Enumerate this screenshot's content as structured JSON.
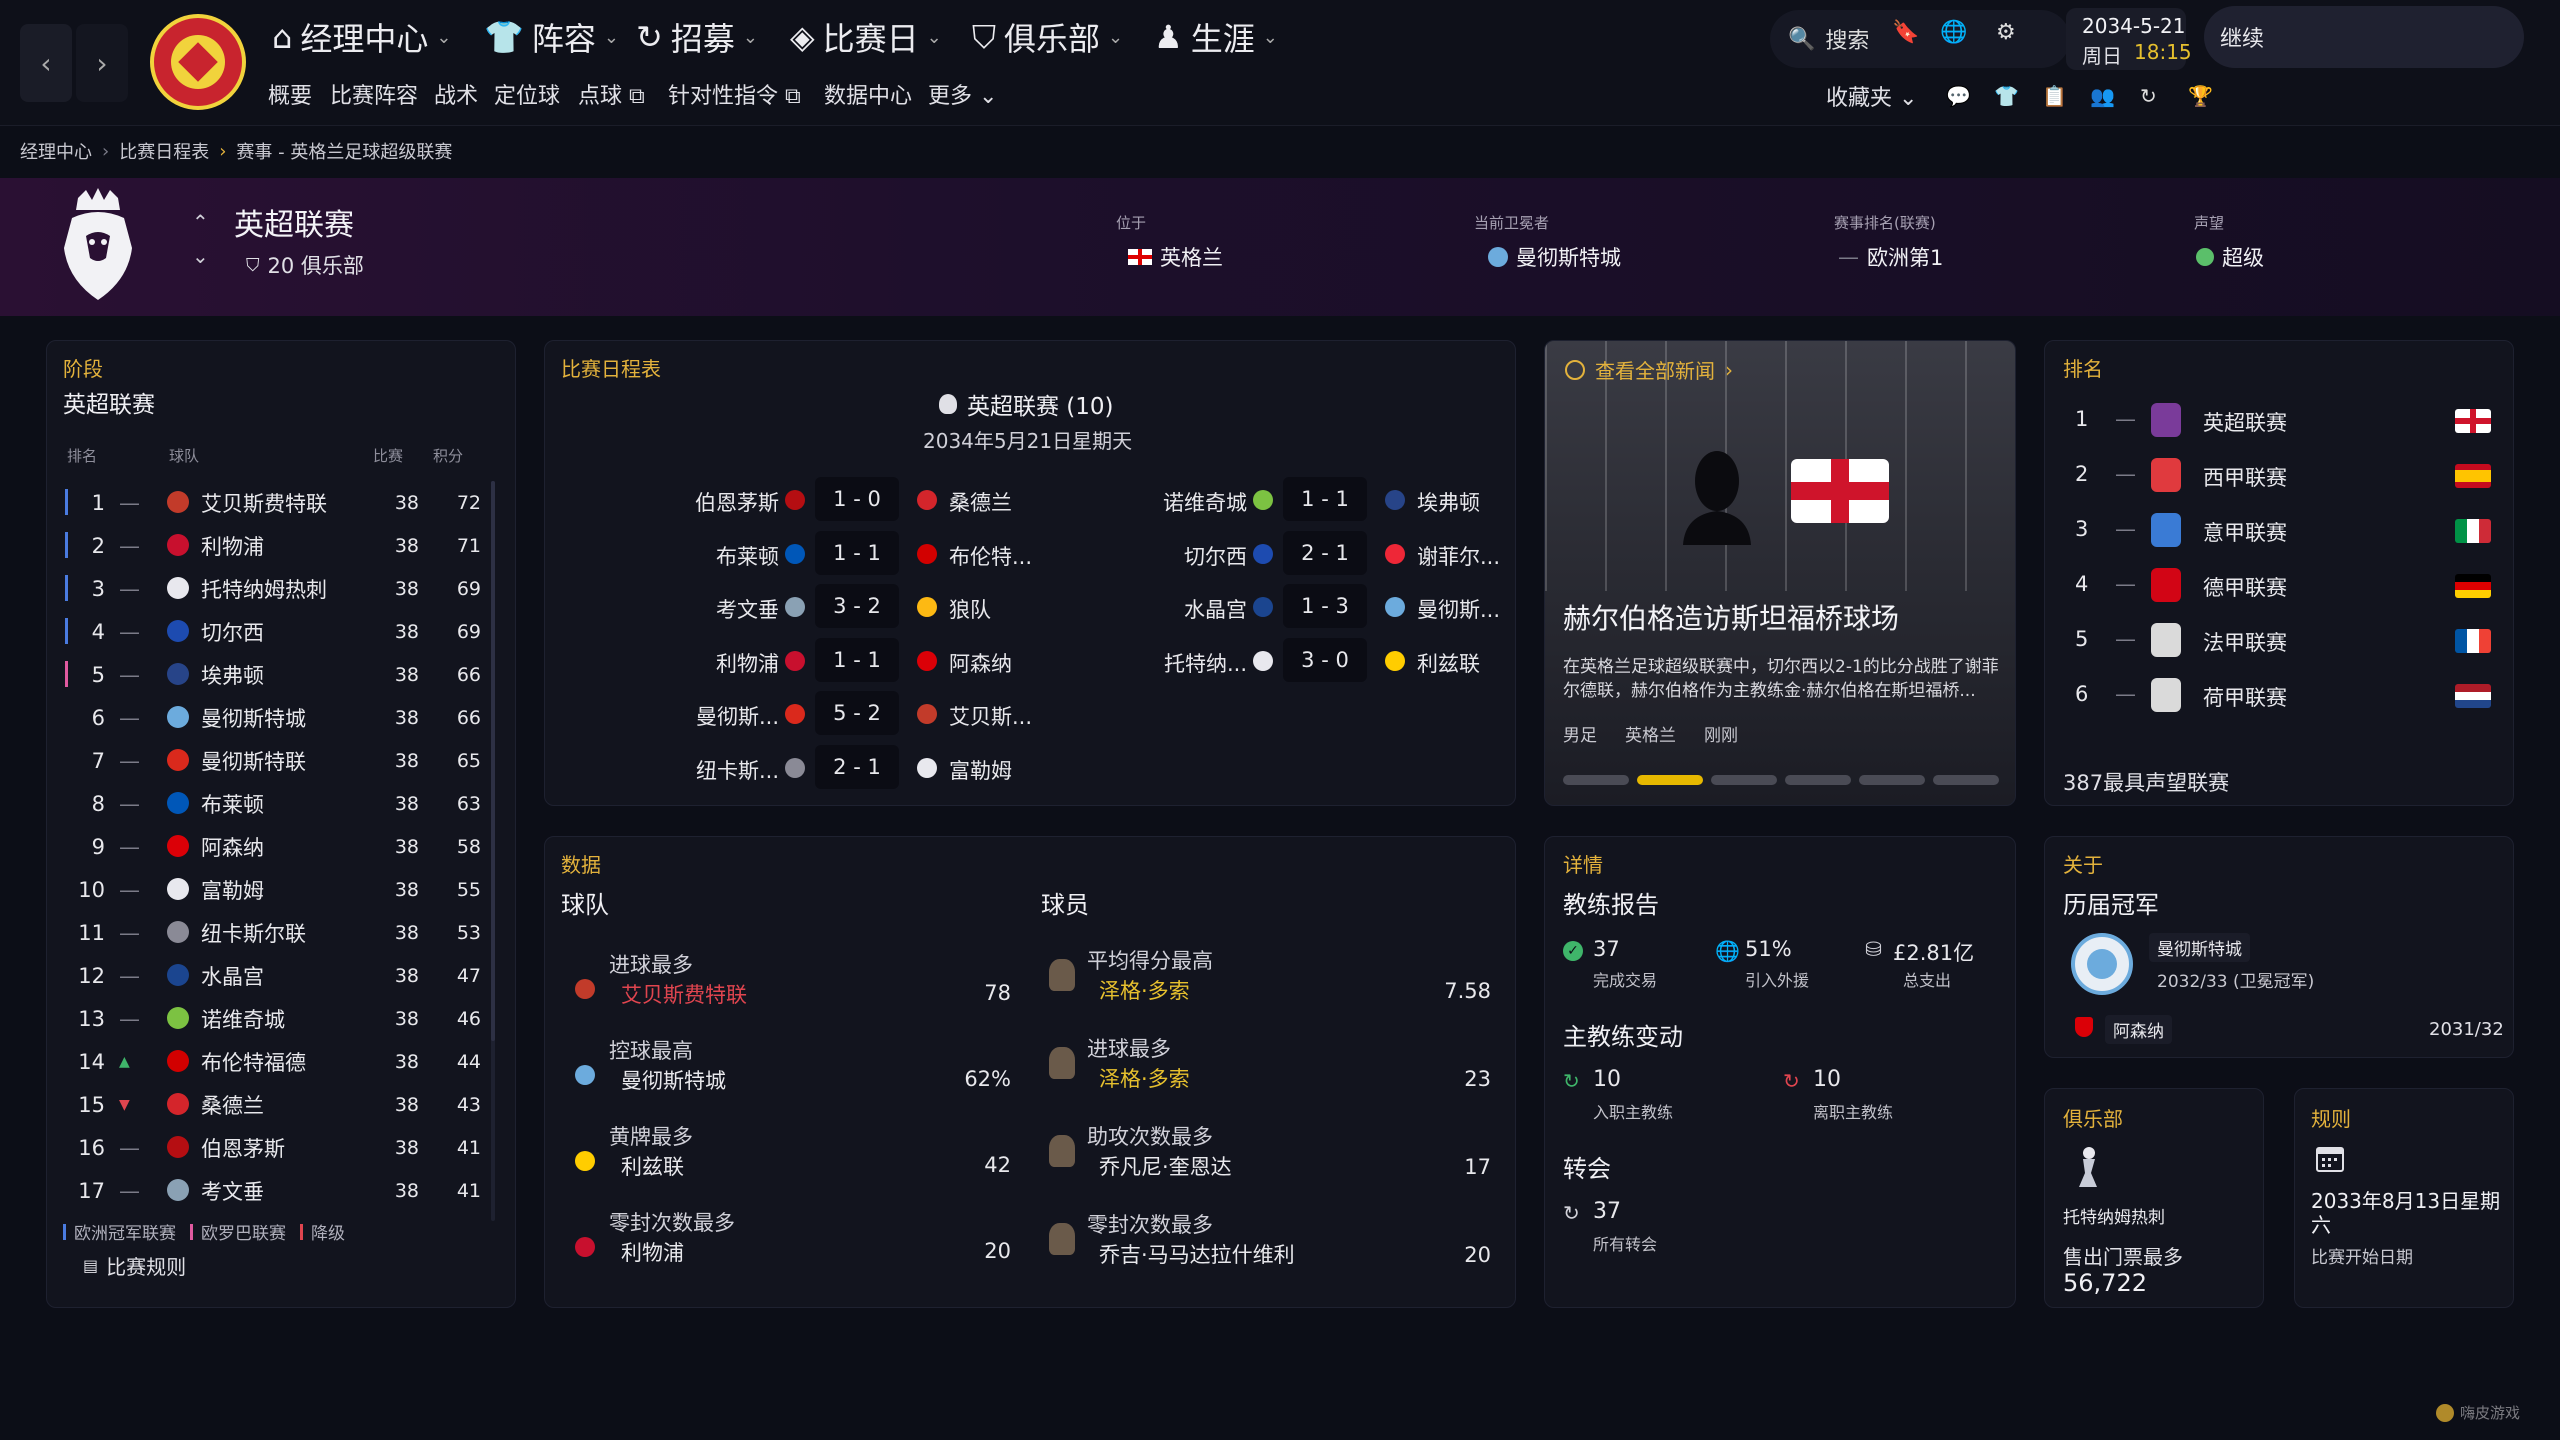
{
  "top_nav": {
    "menus": [
      "经理中心",
      "阵容",
      "招募",
      "比赛日",
      "俱乐部",
      "生涯"
    ],
    "submenu": [
      "概要",
      "比赛阵容",
      "战术",
      "定位球",
      "点球",
      "针对性指令",
      "数据中心",
      "更多"
    ],
    "search_label": "搜索",
    "favorites_label": "收藏夹",
    "date": "2034-5-21",
    "weekday": "周日",
    "time": "18:15",
    "continue_label": "继续"
  },
  "breadcrumb": [
    "经理中心",
    "比赛日程表",
    "赛事 - 英格兰足球超级联赛"
  ],
  "competition": {
    "name": "英超联赛",
    "clubs": "20 俱乐部",
    "location_label": "位于",
    "location": "英格兰",
    "holder_label": "当前卫冕者",
    "holder": "曼彻斯特城",
    "ranking_label": "赛事排名(联赛)",
    "ranking": "欧洲第1",
    "reputation_label": "声望",
    "reputation": "超级"
  },
  "stage": {
    "title": "阶段",
    "name": "英超联赛",
    "headers": [
      "排名",
      "球队",
      "比赛",
      "积分"
    ],
    "rows": [
      {
        "rank": "1",
        "trend": "—",
        "team": "艾贝斯费特联",
        "played": "38",
        "pts": "72",
        "zone": "#4a7be0",
        "crest": "#c23b2a"
      },
      {
        "rank": "2",
        "trend": "—",
        "team": "利物浦",
        "played": "38",
        "pts": "71",
        "zone": "#4a7be0",
        "crest": "#c8102e"
      },
      {
        "rank": "3",
        "trend": "—",
        "team": "托特纳姆热刺",
        "played": "38",
        "pts": "69",
        "zone": "#4a7be0",
        "crest": "#e8e8ee"
      },
      {
        "rank": "4",
        "trend": "—",
        "team": "切尔西",
        "played": "38",
        "pts": "69",
        "zone": "#4a7be0",
        "crest": "#1d4bb0"
      },
      {
        "rank": "5",
        "trend": "—",
        "team": "埃弗顿",
        "played": "38",
        "pts": "66",
        "zone": "#e05aa0",
        "crest": "#274488"
      },
      {
        "rank": "6",
        "trend": "—",
        "team": "曼彻斯特城",
        "played": "38",
        "pts": "66",
        "zone": "",
        "crest": "#6cabdd"
      },
      {
        "rank": "7",
        "trend": "—",
        "team": "曼彻斯特联",
        "played": "38",
        "pts": "65",
        "zone": "",
        "crest": "#da291c"
      },
      {
        "rank": "8",
        "trend": "—",
        "team": "布莱顿",
        "played": "38",
        "pts": "63",
        "zone": "",
        "crest": "#0057b8"
      },
      {
        "rank": "9",
        "trend": "—",
        "team": "阿森纳",
        "played": "38",
        "pts": "58",
        "zone": "",
        "crest": "#db0007"
      },
      {
        "rank": "10",
        "trend": "—",
        "team": "富勒姆",
        "played": "38",
        "pts": "55",
        "zone": "",
        "crest": "#e8e8ee"
      },
      {
        "rank": "11",
        "trend": "—",
        "team": "纽卡斯尔联",
        "played": "38",
        "pts": "53",
        "zone": "",
        "crest": "#8a8a96"
      },
      {
        "rank": "12",
        "trend": "—",
        "team": "水晶宫",
        "played": "38",
        "pts": "47",
        "zone": "",
        "crest": "#1b458f"
      },
      {
        "rank": "13",
        "trend": "—",
        "team": "诺维奇城",
        "played": "38",
        "pts": "46",
        "zone": "",
        "crest": "#7cc242"
      },
      {
        "rank": "14",
        "trend": "▲",
        "team": "布伦特福德",
        "played": "38",
        "pts": "44",
        "zone": "",
        "crest": "#d20000"
      },
      {
        "rank": "15",
        "trend": "▼",
        "team": "桑德兰",
        "played": "38",
        "pts": "43",
        "zone": "",
        "crest": "#d4252b"
      },
      {
        "rank": "16",
        "trend": "—",
        "team": "伯恩茅斯",
        "played": "38",
        "pts": "41",
        "zone": "",
        "crest": "#b50e12"
      },
      {
        "rank": "17",
        "trend": "—",
        "team": "考文垂",
        "played": "38",
        "pts": "41",
        "zone": "",
        "crest": "#8aa1b4"
      }
    ],
    "legend": [
      "欧洲冠军联赛",
      "欧罗巴联赛",
      "降级"
    ],
    "legend_colors": [
      "#4a7be0",
      "#e05aa0",
      "#e0454f"
    ],
    "rules_link": "比赛规则"
  },
  "fixtures": {
    "title": "比赛日程表",
    "round": "英超联赛 (10)",
    "date": "2034年5月21日星期天",
    "left": [
      {
        "home": "伯恩茅斯",
        "score": "1 - 0",
        "away": "桑德兰",
        "hc": "#b50e12",
        "ac": "#d4252b"
      },
      {
        "home": "布莱顿",
        "score": "1 - 1",
        "away": "布伦特...",
        "hc": "#0057b8",
        "ac": "#d20000"
      },
      {
        "home": "考文垂",
        "score": "3 - 2",
        "away": "狼队",
        "hc": "#8aa1b4",
        "ac": "#fdb913"
      },
      {
        "home": "利物浦",
        "score": "1 - 1",
        "away": "阿森纳",
        "hc": "#c8102e",
        "ac": "#db0007"
      },
      {
        "home": "曼彻斯...",
        "score": "5 - 2",
        "away": "艾贝斯...",
        "hc": "#da291c",
        "ac": "#c23b2a"
      },
      {
        "home": "纽卡斯...",
        "score": "2 - 1",
        "away": "富勒姆",
        "hc": "#8a8a96",
        "ac": "#e8e8ee"
      }
    ],
    "right": [
      {
        "home": "诺维奇城",
        "score": "1 - 1",
        "away": "埃弗顿",
        "hc": "#7cc242",
        "ac": "#274488"
      },
      {
        "home": "切尔西",
        "score": "2 - 1",
        "away": "谢菲尔...",
        "hc": "#1d4bb0",
        "ac": "#ee2737"
      },
      {
        "home": "水晶宫",
        "score": "1 - 3",
        "away": "曼彻斯...",
        "hc": "#1b458f",
        "ac": "#6cabdd"
      },
      {
        "home": "托特纳...",
        "score": "3 - 0",
        "away": "利兹联",
        "hc": "#e8e8ee",
        "ac": "#ffcd00"
      }
    ]
  },
  "news": {
    "link": "查看全部新闻",
    "headline": "赫尔伯格造访斯坦福桥球场",
    "body": "在英格兰足球超级联赛中，切尔西以2-1的比分战胜了谢菲尔德联，赫尔伯格作为主教练金·赫尔伯格在斯坦福桥...",
    "tags": [
      "男足",
      "英格兰",
      "刚刚"
    ],
    "pager_count": 6,
    "pager_active": 1
  },
  "rankings": {
    "title": "排名",
    "items": [
      {
        "rank": "1",
        "name": "英超联赛",
        "flag": "england",
        "logo": "#7a3b9a"
      },
      {
        "rank": "2",
        "name": "西甲联赛",
        "flag": "spain",
        "logo": "#e03a3e"
      },
      {
        "rank": "3",
        "name": "意甲联赛",
        "flag": "italy",
        "logo": "#3a7bd5"
      },
      {
        "rank": "4",
        "name": "德甲联赛",
        "flag": "germany",
        "logo": "#d20515"
      },
      {
        "rank": "5",
        "name": "法甲联赛",
        "flag": "france",
        "logo": "#dadada"
      },
      {
        "rank": "6",
        "name": "荷甲联赛",
        "flag": "netherlands",
        "logo": "#dadada"
      }
    ],
    "trend": "—",
    "footer": "387最具声望联赛"
  },
  "data": {
    "title": "数据",
    "team_heading": "球队",
    "player_heading": "球员",
    "team_stats": [
      {
        "label": "进球最多",
        "value": "艾贝斯费特联",
        "num": "78",
        "color": "#e0454f",
        "ic": "#c23b2a"
      },
      {
        "label": "控球最高",
        "value": "曼彻斯特城",
        "num": "62%",
        "color": "#e8e8ec",
        "ic": "#6cabdd"
      },
      {
        "label": "黄牌最多",
        "value": "利兹联",
        "num": "42",
        "color": "#e8e8ec",
        "ic": "#ffcd00"
      },
      {
        "label": "零封次数最多",
        "value": "利物浦",
        "num": "20",
        "color": "#e8e8ec",
        "ic": "#c8102e"
      }
    ],
    "player_stats": [
      {
        "label": "平均得分最高",
        "value": "泽格·多索",
        "num": "7.58",
        "color": "#e6c02e"
      },
      {
        "label": "进球最多",
        "value": "泽格·多索",
        "num": "23",
        "color": "#e6c02e"
      },
      {
        "label": "助攻次数最多",
        "value": "乔凡尼·奎恩达",
        "num": "17",
        "color": "#e8e8ec"
      },
      {
        "label": "零封次数最多",
        "value": "乔吉·马马达拉什维利",
        "num": "20",
        "color": "#e8e8ec"
      }
    ]
  },
  "details": {
    "title": "详情",
    "coach_report": "教练报告",
    "completed_value": "37",
    "completed_label": "完成交易",
    "incoming_value": "51%",
    "incoming_label": "引入外援",
    "spend_value": "£2.81亿",
    "spend_label": "总支出",
    "coach_changes": "主教练变动",
    "hired_value": "10",
    "hired_label": "入职主教练",
    "left_value": "10",
    "left_label": "离职主教练",
    "transfers": "转会",
    "transfers_value": "37",
    "transfers_label": "所有转会"
  },
  "about": {
    "title": "关于",
    "champions_heading": "历届冠军",
    "champion": "曼彻斯特城",
    "champion_season": "2032/33 (卫冕冠军)",
    "prev_champion": "阿森纳",
    "prev_season": "2031/32"
  },
  "club": {
    "title": "俱乐部",
    "name": "托特纳姆热刺",
    "attendance_label": "售出门票最多",
    "attendance": "56,722"
  },
  "rules": {
    "title": "规则",
    "date": "2033年8月13日星期六",
    "caption": "比赛开始日期"
  },
  "watermark": "嗨皮游戏"
}
